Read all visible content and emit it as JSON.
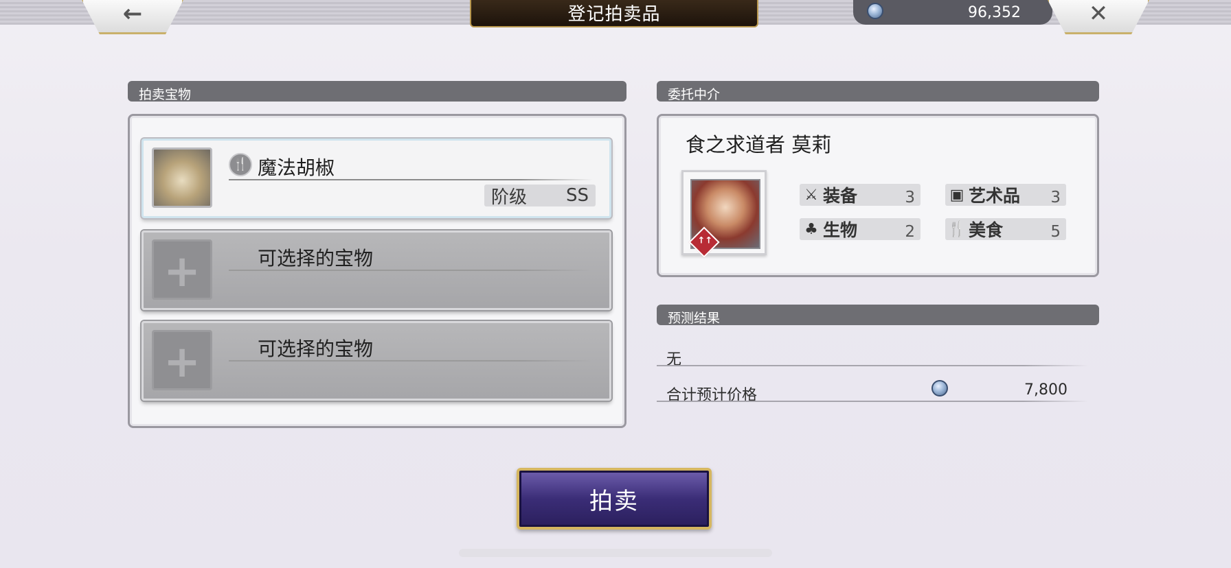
{
  "header": {
    "title": "登记拍卖品",
    "back_glyph": "←",
    "close_glyph": "✕",
    "currency_amount": "96,352"
  },
  "treasure_section": {
    "heading": "拍卖宝物",
    "slots": [
      {
        "name": "魔法胡椒",
        "rank_label": "阶级",
        "rank_value": "SS",
        "badge_glyph": "🍴"
      },
      {
        "name": "可选择的宝物",
        "plus": "+"
      },
      {
        "name": "可选择的宝物",
        "plus": "+"
      }
    ]
  },
  "agent_section": {
    "heading": "委托中介",
    "agent_name": "食之求道者 莫莉",
    "rank_badge": "↑↑",
    "stats": [
      {
        "icon": "sword-icon",
        "glyph": "⚔",
        "label": "装备",
        "count": "3"
      },
      {
        "icon": "art-icon",
        "glyph": "▣",
        "label": "艺术品",
        "count": "3"
      },
      {
        "icon": "creature-icon",
        "glyph": "♣",
        "label": "生物",
        "count": "2"
      },
      {
        "icon": "food-icon",
        "glyph": "🍴",
        "label": "美食",
        "count": "5"
      }
    ]
  },
  "forecast_section": {
    "heading": "预测结果",
    "result": "无",
    "total_label": "合计预计价格",
    "total_value": "7,800"
  },
  "auction_button": {
    "label": "拍卖"
  },
  "colors": {
    "accent_gold": "#d6b760",
    "button_purple": "#3b2d77",
    "section_header": "#6e6e73"
  }
}
